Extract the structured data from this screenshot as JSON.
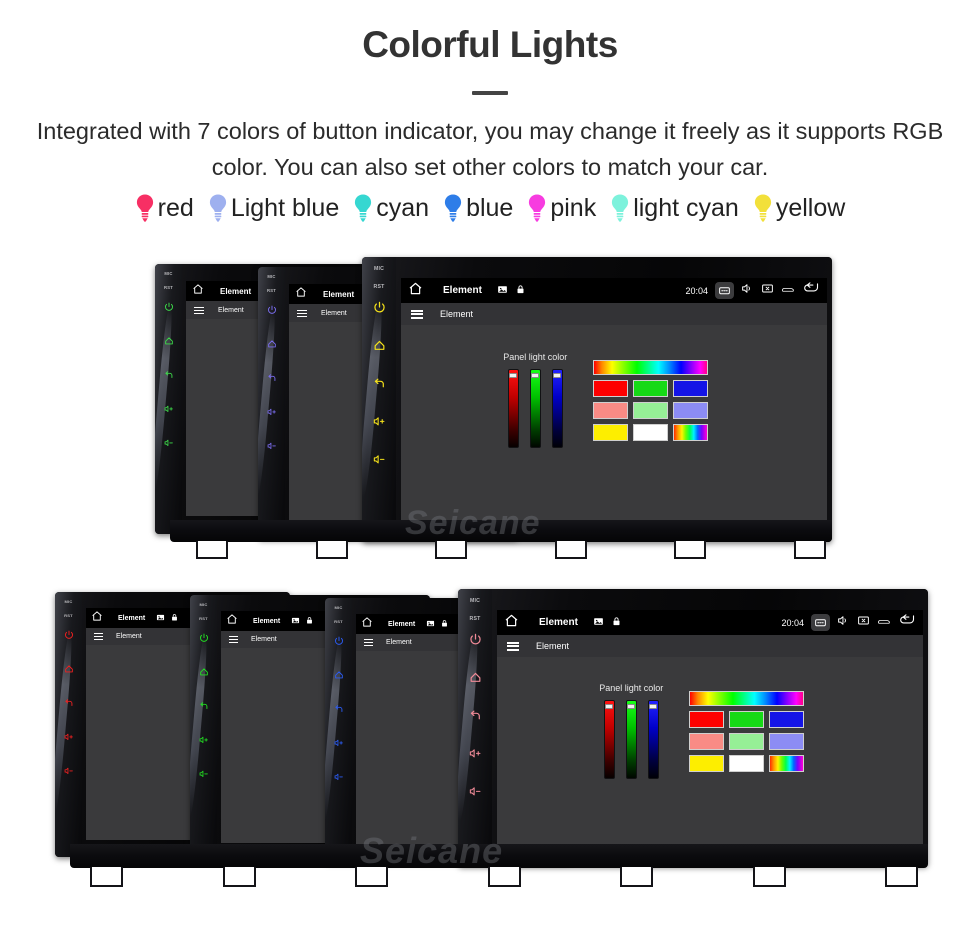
{
  "header": {
    "title": "Colorful Lights",
    "subtitle": "Integrated with 7 colors of button indicator, you may change it freely as it supports RGB color. You can also set other colors to match your car."
  },
  "legend": {
    "items": [
      {
        "label": "red",
        "color": "#f72f64",
        "icon": "bulb-icon"
      },
      {
        "label": "Light blue",
        "color": "#9eb0ef",
        "icon": "bulb-icon"
      },
      {
        "label": "cyan",
        "color": "#36d7d1",
        "icon": "bulb-icon"
      },
      {
        "label": "blue",
        "color": "#2e7de8",
        "icon": "bulb-icon"
      },
      {
        "label": "pink",
        "color": "#f73ce0",
        "icon": "bulb-icon"
      },
      {
        "label": "light cyan",
        "color": "#7df2dc",
        "icon": "bulb-icon"
      },
      {
        "label": "yellow",
        "color": "#f2e03a",
        "icon": "bulb-icon"
      }
    ]
  },
  "watermark": {
    "text": "Seicane"
  },
  "status_bar": {
    "home_icon": "home-icon",
    "title": "Element",
    "image_icon": "image-icon",
    "lock_icon": "lock-icon",
    "time": "20:04",
    "screenshot_icon": "screenshot-icon",
    "volume_icon": "speaker-icon",
    "screen_off_icon": "screen-off-icon",
    "car_icon": "car-icon",
    "back_icon": "back-arrow-icon"
  },
  "app_bar": {
    "menu_icon": "hamburger-menu-icon",
    "title": "Element"
  },
  "dialog": {
    "label": "Panel light color",
    "sliders": [
      {
        "name": "red-slider",
        "channel": "R",
        "value": 100
      },
      {
        "name": "green-slider",
        "channel": "G",
        "value": 100
      },
      {
        "name": "blue-slider",
        "channel": "B",
        "value": 100
      }
    ],
    "hue_bar": "hue-gradient-bar",
    "swatches": [
      [
        "#fe0000",
        "#16d916",
        "#1414e6"
      ],
      [
        "#f98b85",
        "#96ef96",
        "#8c8cf4"
      ],
      [
        "#fdee00",
        "#ffffff",
        "rainbow"
      ]
    ]
  },
  "side_buttons": {
    "mic_label": "MIC",
    "reset_label": "RST",
    "icons": [
      "power-icon",
      "home-icon",
      "back-icon",
      "volume-up-icon",
      "volume-down-icon"
    ]
  },
  "units": {
    "top_row": [
      {
        "name": "unit-top-green",
        "light_color": "#3ddc4a"
      },
      {
        "name": "unit-top-purple",
        "light_color": "#7b6df0"
      },
      {
        "name": "unit-top-yellow",
        "light_color": "#f5e21a"
      }
    ],
    "bottom_row": [
      {
        "name": "unit-bottom-red",
        "light_color": "#ef2020"
      },
      {
        "name": "unit-bottom-green",
        "light_color": "#22e022"
      },
      {
        "name": "unit-bottom-blue",
        "light_color": "#2b5cf5"
      },
      {
        "name": "unit-bottom-pink",
        "light_color": "#f08a97"
      }
    ]
  }
}
